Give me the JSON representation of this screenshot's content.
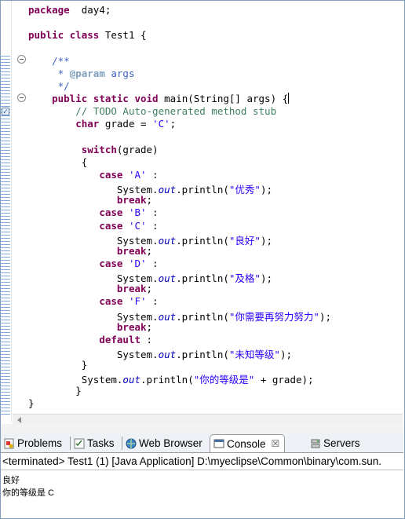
{
  "editor": {
    "lines": [
      {
        "parts": [
          [
            "kw",
            "package"
          ],
          [
            "",
            "  day4;"
          ]
        ]
      },
      {
        "parts": []
      },
      {
        "parts": [
          [
            "kw",
            "public"
          ],
          [
            "",
            " "
          ],
          [
            "kw",
            "class"
          ],
          [
            "",
            " Test1 {"
          ]
        ]
      },
      {
        "parts": []
      },
      {
        "parts": [
          [
            "",
            "    "
          ],
          [
            "jd",
            "/**"
          ]
        ]
      },
      {
        "parts": [
          [
            "",
            "     "
          ],
          [
            "jd",
            "* "
          ],
          [
            "tag",
            "@param"
          ],
          [
            "jd",
            " args"
          ]
        ]
      },
      {
        "parts": [
          [
            "",
            "     "
          ],
          [
            "jd",
            "*/"
          ]
        ]
      },
      {
        "parts": [
          [
            "",
            "    "
          ],
          [
            "kw",
            "public"
          ],
          [
            "",
            " "
          ],
          [
            "kw",
            "static"
          ],
          [
            "",
            " "
          ],
          [
            "kw",
            "void"
          ],
          [
            "",
            " main(String[] args) {"
          ]
        ]
      },
      {
        "parts": [
          [
            "",
            "        "
          ],
          [
            "cm",
            "// TODO Auto-generated method stub"
          ]
        ]
      },
      {
        "parts": [
          [
            "",
            "        "
          ],
          [
            "kw",
            "char"
          ],
          [
            "",
            " grade = "
          ],
          [
            "str",
            "'C'"
          ],
          [
            "",
            ";"
          ]
        ]
      },
      {
        "parts": []
      },
      {
        "parts": [
          [
            "",
            "         "
          ],
          [
            "kw",
            "switch"
          ],
          [
            "",
            "(grade)"
          ]
        ]
      },
      {
        "parts": [
          [
            "",
            "         {"
          ]
        ]
      },
      {
        "parts": [
          [
            "",
            "            "
          ],
          [
            "kw",
            "case"
          ],
          [
            "",
            " "
          ],
          [
            "str",
            "'A'"
          ],
          [
            "",
            " :"
          ]
        ]
      },
      {
        "parts": [
          [
            "",
            "               System."
          ],
          [
            "fld",
            "out"
          ],
          [
            "",
            ".println("
          ],
          [
            "str",
            "\"优秀\""
          ],
          [
            "",
            ");"
          ]
        ]
      },
      {
        "parts": [
          [
            "",
            "               "
          ],
          [
            "kw",
            "break"
          ],
          [
            "",
            ";"
          ]
        ]
      },
      {
        "parts": [
          [
            "",
            "            "
          ],
          [
            "kw",
            "case"
          ],
          [
            "",
            " "
          ],
          [
            "str",
            "'B'"
          ],
          [
            "",
            " :"
          ]
        ]
      },
      {
        "parts": [
          [
            "",
            "            "
          ],
          [
            "kw",
            "case"
          ],
          [
            "",
            " "
          ],
          [
            "str",
            "'C'"
          ],
          [
            "",
            " :"
          ]
        ]
      },
      {
        "parts": [
          [
            "",
            "               System."
          ],
          [
            "fld",
            "out"
          ],
          [
            "",
            ".println("
          ],
          [
            "str",
            "\"良好\""
          ],
          [
            "",
            ");"
          ]
        ]
      },
      {
        "parts": [
          [
            "",
            "               "
          ],
          [
            "kw",
            "break"
          ],
          [
            "",
            ";"
          ]
        ]
      },
      {
        "parts": [
          [
            "",
            "            "
          ],
          [
            "kw",
            "case"
          ],
          [
            "",
            " "
          ],
          [
            "str",
            "'D'"
          ],
          [
            "",
            " :"
          ]
        ]
      },
      {
        "parts": [
          [
            "",
            "               System."
          ],
          [
            "fld",
            "out"
          ],
          [
            "",
            ".println("
          ],
          [
            "str",
            "\"及格\""
          ],
          [
            "",
            ");"
          ]
        ]
      },
      {
        "parts": [
          [
            "",
            "               "
          ],
          [
            "kw",
            "break"
          ],
          [
            "",
            ";"
          ]
        ]
      },
      {
        "parts": [
          [
            "",
            "            "
          ],
          [
            "kw",
            "case"
          ],
          [
            "",
            " "
          ],
          [
            "str",
            "'F'"
          ],
          [
            "",
            " :"
          ]
        ]
      },
      {
        "parts": [
          [
            "",
            "               System."
          ],
          [
            "fld",
            "out"
          ],
          [
            "",
            ".println("
          ],
          [
            "str",
            "\"你需要再努力努力\""
          ],
          [
            "",
            ");"
          ]
        ]
      },
      {
        "parts": [
          [
            "",
            "               "
          ],
          [
            "kw",
            "break"
          ],
          [
            "",
            ";"
          ]
        ]
      },
      {
        "parts": [
          [
            "",
            "            "
          ],
          [
            "kw",
            "default"
          ],
          [
            "",
            " :"
          ]
        ]
      },
      {
        "parts": [
          [
            "",
            "               System."
          ],
          [
            "fld",
            "out"
          ],
          [
            "",
            ".println("
          ],
          [
            "str",
            "\"未知等级\""
          ],
          [
            "",
            ");"
          ]
        ]
      },
      {
        "parts": [
          [
            "",
            "         }"
          ]
        ]
      },
      {
        "parts": [
          [
            "",
            "         System."
          ],
          [
            "fld",
            "out"
          ],
          [
            "",
            ".println("
          ],
          [
            "str",
            "\"你的等级是\""
          ],
          [
            "",
            " + grade);"
          ]
        ]
      },
      {
        "parts": [
          [
            "",
            "        }"
          ]
        ]
      },
      {
        "parts": [
          [
            "",
            "}"
          ]
        ]
      }
    ]
  },
  "tabs": {
    "problems": "Problems",
    "tasks": "Tasks",
    "web_browser": "Web Browser",
    "console": "Console",
    "close": "☒",
    "servers": "Servers"
  },
  "console": {
    "header": "<terminated> Test1 (1) [Java Application] D:\\myeclipse\\Common\\binary\\com.sun.",
    "output": [
      "良好",
      "你的等级是 C"
    ]
  },
  "colors": {
    "keyword": "#7f0055",
    "string": "#2a00ff",
    "comment": "#3f7f5f",
    "javadoc": "#3f5fbf",
    "field": "#0000c0"
  },
  "icons": [
    "fold-icon",
    "task-marker-icon",
    "problems-icon",
    "tasks-icon",
    "web-browser-icon",
    "console-icon",
    "servers-icon",
    "scroll-left-icon"
  ]
}
